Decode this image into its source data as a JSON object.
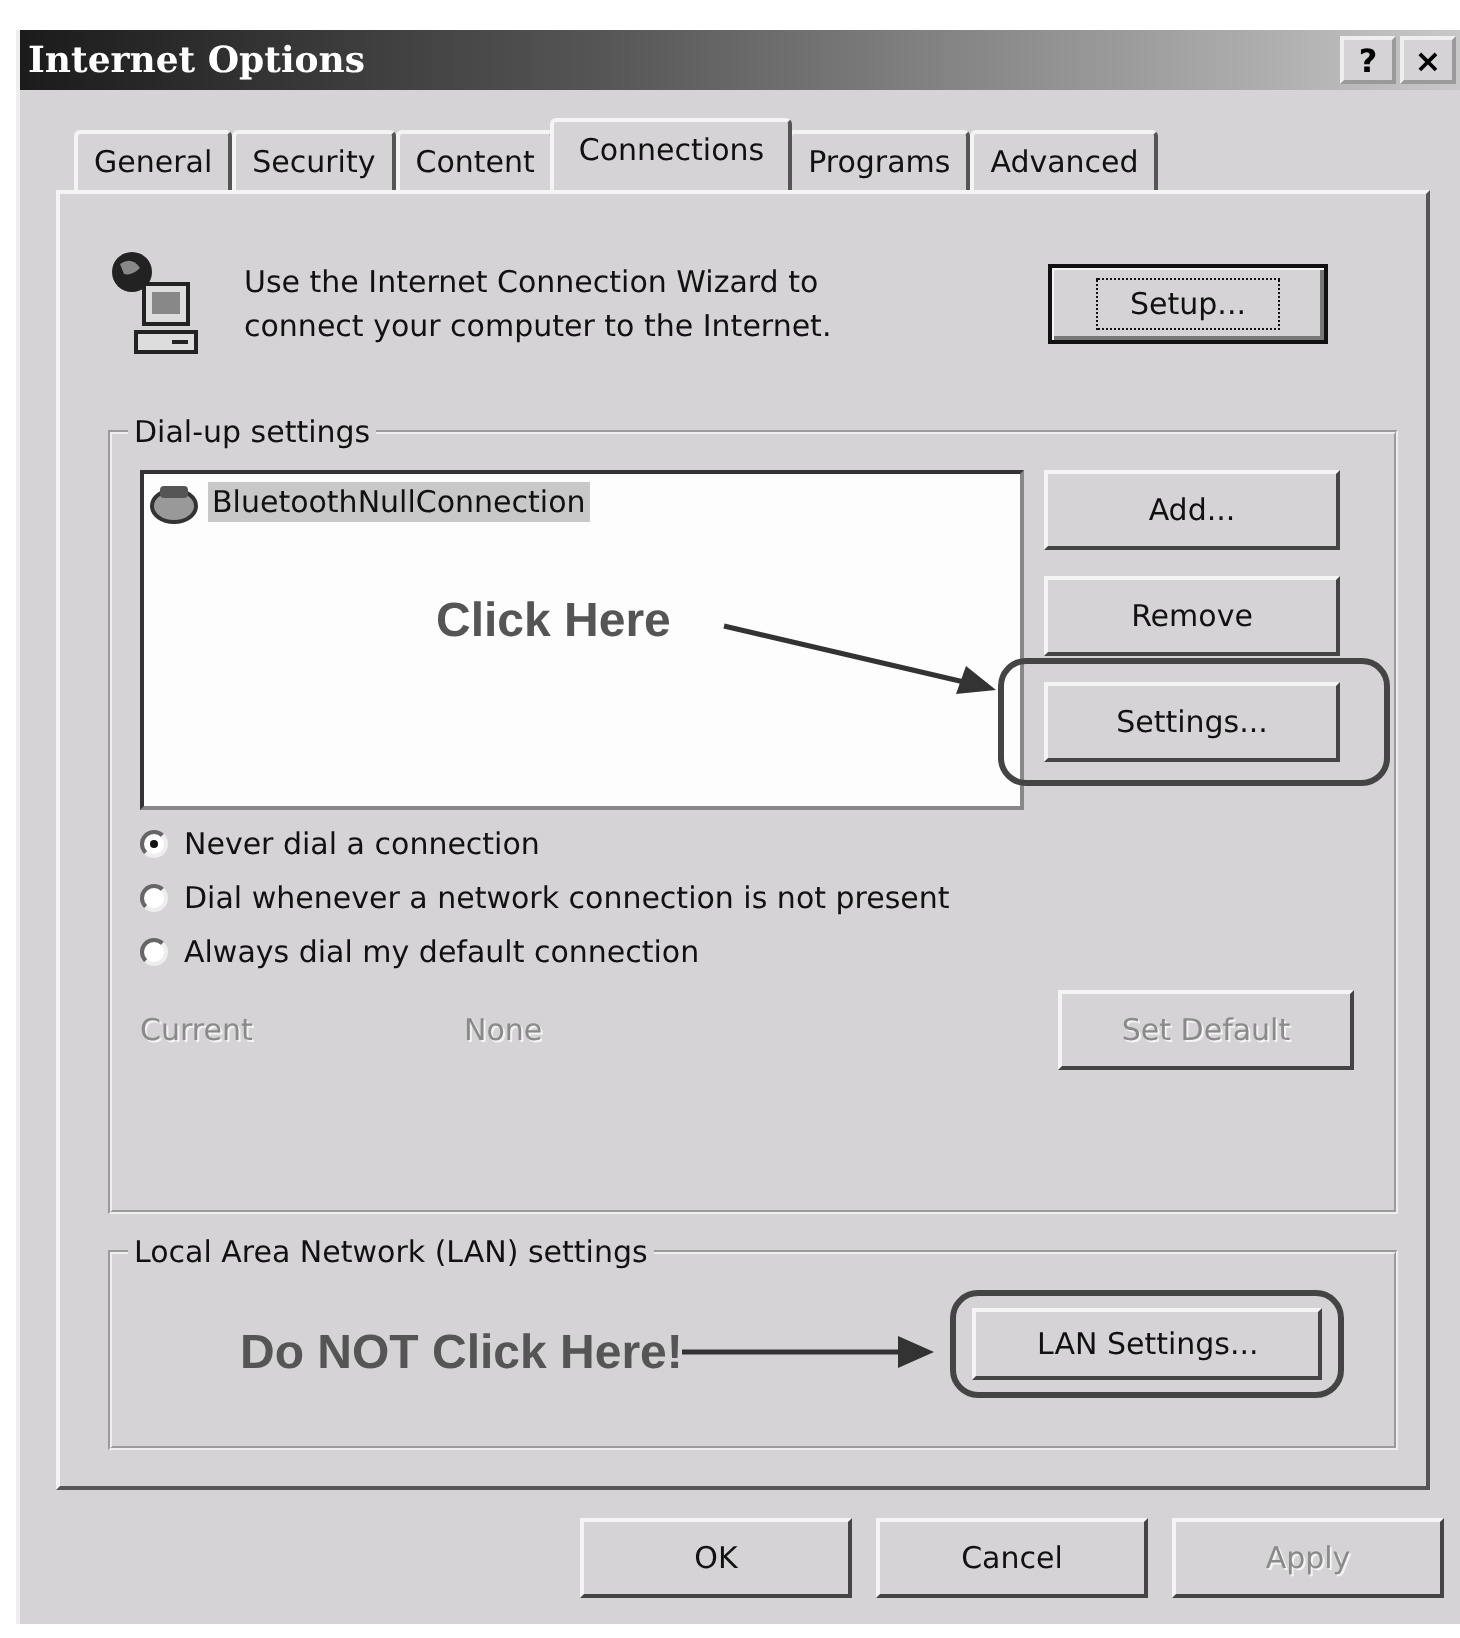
{
  "window": {
    "title": "Internet Options",
    "title_buttons": [
      "?",
      "×"
    ]
  },
  "tabs": [
    {
      "label": "General",
      "selected": false
    },
    {
      "label": "Security",
      "selected": false
    },
    {
      "label": "Content",
      "selected": false
    },
    {
      "label": "Connections",
      "selected": true
    },
    {
      "label": "Programs",
      "selected": false
    },
    {
      "label": "Advanced",
      "selected": false
    }
  ],
  "wizard": {
    "text": "Use the Internet Connection Wizard to connect your computer to the Internet.",
    "button": {
      "label": "Setup...",
      "focused": true
    }
  },
  "dialup": {
    "legend": "Dial-up settings",
    "connections": [
      {
        "name": "BluetoothNullConnection",
        "selected": true
      }
    ],
    "annotation": "Click Here",
    "buttons": [
      {
        "label": "Add...",
        "highlighted": false
      },
      {
        "label": "Remove",
        "highlighted": false
      },
      {
        "label": "Settings...",
        "highlighted": true
      }
    ],
    "options": [
      {
        "label": "Never dial a connection",
        "selected": true
      },
      {
        "label": "Dial whenever a network connection is not present",
        "selected": false
      },
      {
        "label": "Always dial my default connection",
        "selected": false
      }
    ],
    "current_label": "Current",
    "current_value": "None",
    "set_default": {
      "label": "Set Default",
      "disabled": true
    }
  },
  "lan": {
    "legend": "Local Area Network (LAN) settings",
    "annotation": "Do NOT Click Here!",
    "button": {
      "label": "LAN Settings...",
      "highlighted": true
    }
  },
  "footer": [
    {
      "label": "OK",
      "disabled": false
    },
    {
      "label": "Cancel",
      "disabled": false
    },
    {
      "label": "Apply",
      "disabled": true
    }
  ]
}
